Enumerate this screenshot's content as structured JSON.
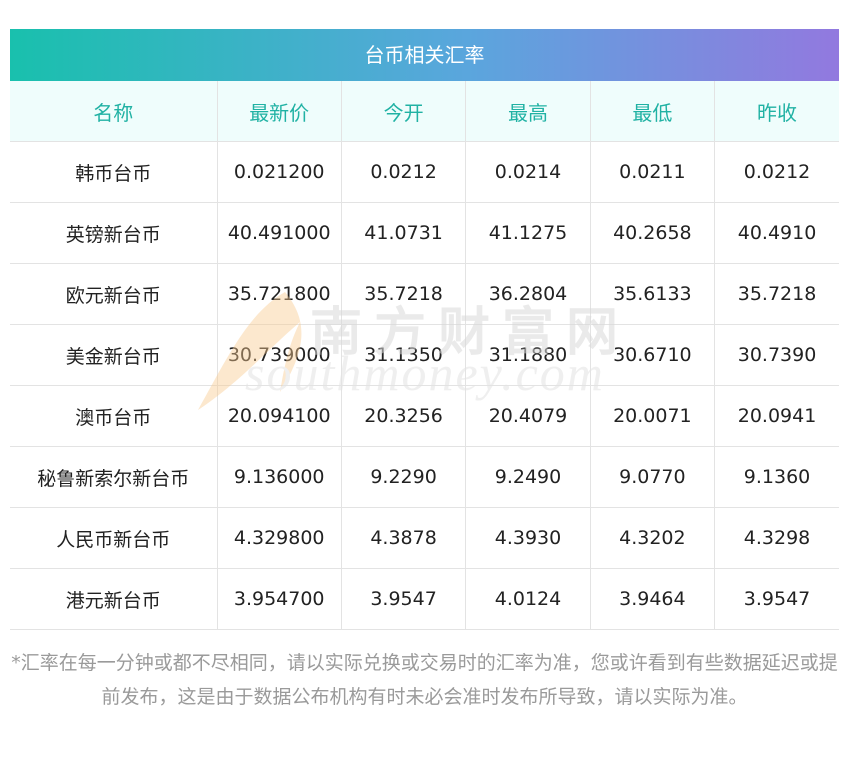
{
  "title": "台币相关汇率",
  "columns": [
    "名称",
    "最新价",
    "今开",
    "最高",
    "最低",
    "昨收"
  ],
  "rows": [
    [
      "韩币台币",
      "0.021200",
      "0.0212",
      "0.0214",
      "0.0211",
      "0.0212"
    ],
    [
      "英镑新台币",
      "40.491000",
      "41.0731",
      "41.1275",
      "40.2658",
      "40.4910"
    ],
    [
      "欧元新台币",
      "35.721800",
      "35.7218",
      "36.2804",
      "35.6133",
      "35.7218"
    ],
    [
      "美金新台币",
      "30.739000",
      "31.1350",
      "31.1880",
      "30.6710",
      "30.7390"
    ],
    [
      "澳币台币",
      "20.094100",
      "20.3256",
      "20.4079",
      "20.0071",
      "20.0941"
    ],
    [
      "秘鲁新索尔新台币",
      "9.136000",
      "9.2290",
      "9.2490",
      "9.0770",
      "9.1360"
    ],
    [
      "人民币新台币",
      "4.329800",
      "4.3878",
      "4.3930",
      "4.3202",
      "4.3298"
    ],
    [
      "港元新台币",
      "3.954700",
      "3.9547",
      "4.0124",
      "3.9464",
      "3.9547"
    ]
  ],
  "watermark": {
    "brand_cn": "南方财富网",
    "brand_en": "southmoney.com"
  },
  "note": "*汇率在每一分钟或都不尽相同，请以实际兑换或交易时的汇率为准，您或许看到有些数据延迟或提前发布，这是由于数据公布机构有时未必会准时发布所导致，请以实际为准。",
  "colors": {
    "gradient_start": "#19c0ad",
    "gradient_end": "#9279df",
    "header_text": "#21b2a4",
    "header_bg": "#effdfc"
  }
}
